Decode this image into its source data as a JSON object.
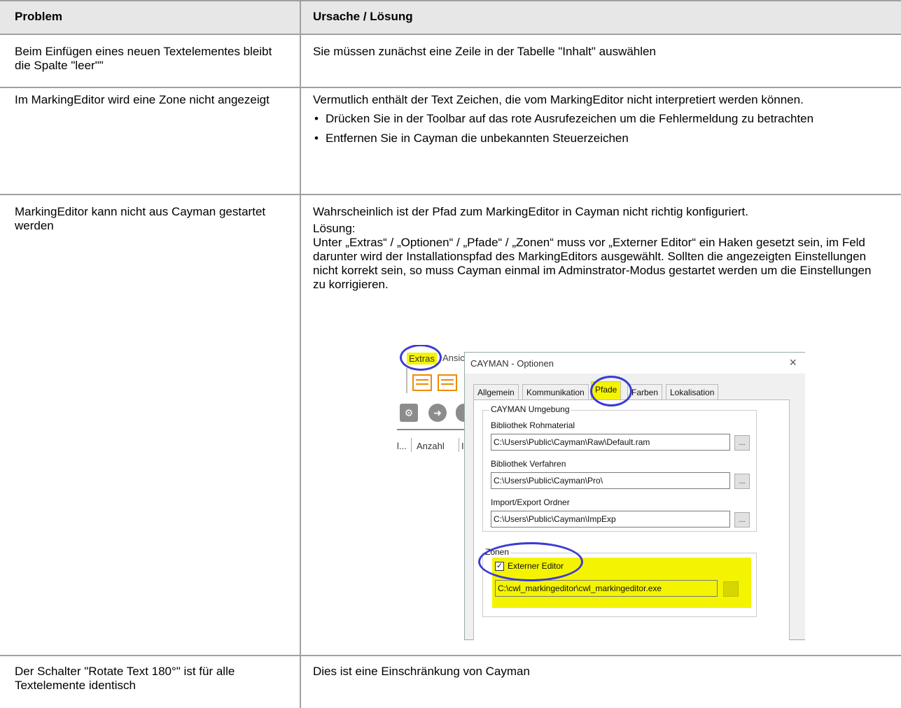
{
  "header": {
    "col1": "Problem",
    "col2": "Ursache / Lösung"
  },
  "rows": [
    {
      "problem": "Beim Einfügen eines neuen Textelementes bleibt die Spalte \"leer\"\"",
      "solution": "Sie müssen zunächst eine Zeile in der Tabelle \"Inhalt\" auswählen"
    },
    {
      "problem": "Im MarkingEditor wird eine Zone nicht angezeigt",
      "solution_intro": "Vermutlich enthält der Text Zeichen, die vom MarkingEditor nicht interpretiert werden können.",
      "bullets": [
        "Drücken Sie in der Toolbar auf das rote Ausrufezeichen um die Fehlermeldung zu betrachten",
        "Entfernen Sie in Cayman die unbekannten Steuerzeichen"
      ]
    },
    {
      "problem": "MarkingEditor kann nicht aus Cayman gestartet werden",
      "solution_p1": "Wahrscheinlich ist der Pfad zum MarkingEditor in Cayman nicht richtig konfiguriert.",
      "solution_p2": "Lösung:",
      "solution_p3": "Unter „Extras“ / „Optionen“ / „Pfade“ / „Zonen“ muss vor „Externer Editor“ ein Haken gesetzt sein, im Feld darunter wird der Installationspfad des MarkingEditors ausgewählt. Sollten die angezeigten Einstellungen nicht korrekt sein, so muss Cayman einmal im Adminstrator-Modus gestartet werden um die Einstellungen zu korrigieren."
    },
    {
      "problem": "Der Schalter \"Rotate Text 180°\" ist für alle Textelemente identisch",
      "solution": "Dies ist eine Einschränkung von Cayman"
    }
  ],
  "screenshot": {
    "menu_extras": "Extras",
    "menu_ansicht": "Ansic",
    "col_a": "l...",
    "col_b": "Anzahl",
    "col_c": "I",
    "dialog_title": "CAYMAN - Optionen",
    "close_glyph": "×",
    "tabs": [
      "Allgemein",
      "Kommunikation",
      "Pfade",
      "Farben",
      "Lokalisation"
    ],
    "group1_label": "CAYMAN Umgebung",
    "field1_label": "Bibliothek Rohmaterial",
    "field1_value": "C:\\Users\\Public\\Cayman\\Raw\\Default.ram",
    "field2_label": "Bibliothek Verfahren",
    "field2_value": "C:\\Users\\Public\\Cayman\\Pro\\",
    "field3_label": "Import/Export Ordner",
    "field3_value": "C:\\Users\\Public\\Cayman\\ImpExp",
    "browse_label": "...",
    "group2_label": "Zonen",
    "checkbox_label": "Externer Editor",
    "checkbox_checked": true,
    "field4_value": "C:\\cwl_markingeditor\\cwl_markingeditor.exe",
    "highlight_color": "#f4f400",
    "ring_color": "#3b3bd6"
  }
}
